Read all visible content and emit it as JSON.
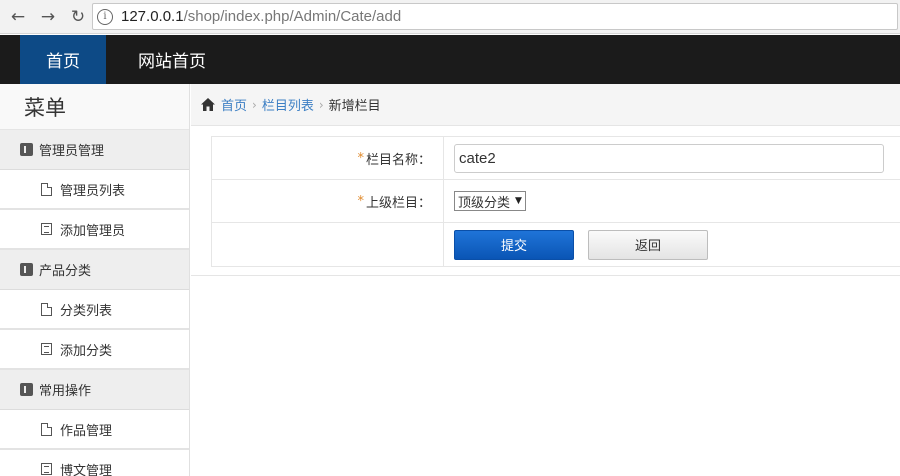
{
  "browser": {
    "back_icon": "←",
    "forward_icon": "→",
    "reload_icon": "↻",
    "info_icon": "i",
    "url_host": "127.0.0.1",
    "url_path": "/shop/index.php/Admin/Cate/add"
  },
  "topnav": {
    "home": "首页",
    "site_home": "网站首页",
    "active_color": "#0d4a86"
  },
  "sidebar": {
    "title": "菜单",
    "groups": [
      {
        "label": "管理员管理",
        "items": [
          {
            "label": "管理员列表",
            "icon": "doc-icon"
          },
          {
            "label": "添加管理员",
            "icon": "list-icon"
          }
        ]
      },
      {
        "label": "产品分类",
        "items": [
          {
            "label": "分类列表",
            "icon": "doc-icon"
          },
          {
            "label": "添加分类",
            "icon": "list-icon"
          }
        ]
      },
      {
        "label": "常用操作",
        "items": [
          {
            "label": "作品管理",
            "icon": "doc-icon"
          },
          {
            "label": "博文管理",
            "icon": "list-icon"
          }
        ]
      }
    ]
  },
  "breadcrumb": {
    "home": "首页",
    "list": "栏目列表",
    "current": "新增栏目",
    "separator": "›"
  },
  "form": {
    "required_mark": "*",
    "name_label": "栏目名称：",
    "name_value": "cate2",
    "parent_label": "上级栏目：",
    "parent_selected": "顶级分类",
    "submit": "提交",
    "back": "返回"
  }
}
